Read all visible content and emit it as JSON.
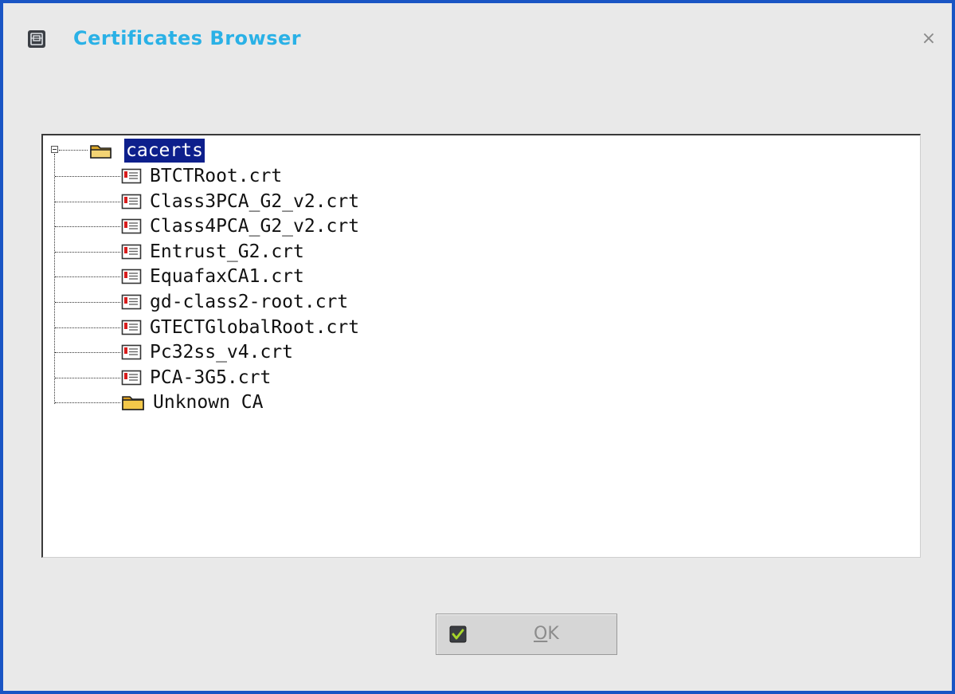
{
  "window": {
    "title": "Certificates Browser",
    "close_symbol": "×",
    "accent_color": "#1a55c4",
    "title_color": "#2ab1e6"
  },
  "tree": {
    "root": {
      "label": "cacerts",
      "icon": "folder-open-icon",
      "expanded": true,
      "selected": true
    },
    "children": [
      {
        "label": "BTCTRoot.crt",
        "icon": "certificate-icon"
      },
      {
        "label": "Class3PCA_G2_v2.crt",
        "icon": "certificate-icon"
      },
      {
        "label": "Class4PCA_G2_v2.crt",
        "icon": "certificate-icon"
      },
      {
        "label": "Entrust_G2.crt",
        "icon": "certificate-icon"
      },
      {
        "label": "EquafaxCA1.crt",
        "icon": "certificate-icon"
      },
      {
        "label": "gd-class2-root.crt",
        "icon": "certificate-icon"
      },
      {
        "label": "GTECTGlobalRoot.crt",
        "icon": "certificate-icon"
      },
      {
        "label": "Pc32ss_v4.crt",
        "icon": "certificate-icon"
      },
      {
        "label": "PCA-3G5.crt",
        "icon": "certificate-icon"
      },
      {
        "label": "Unknown CA",
        "icon": "folder-icon"
      }
    ]
  },
  "buttons": {
    "ok": {
      "mnemonic": "O",
      "rest": "K",
      "icon": "checkmark-icon"
    }
  }
}
